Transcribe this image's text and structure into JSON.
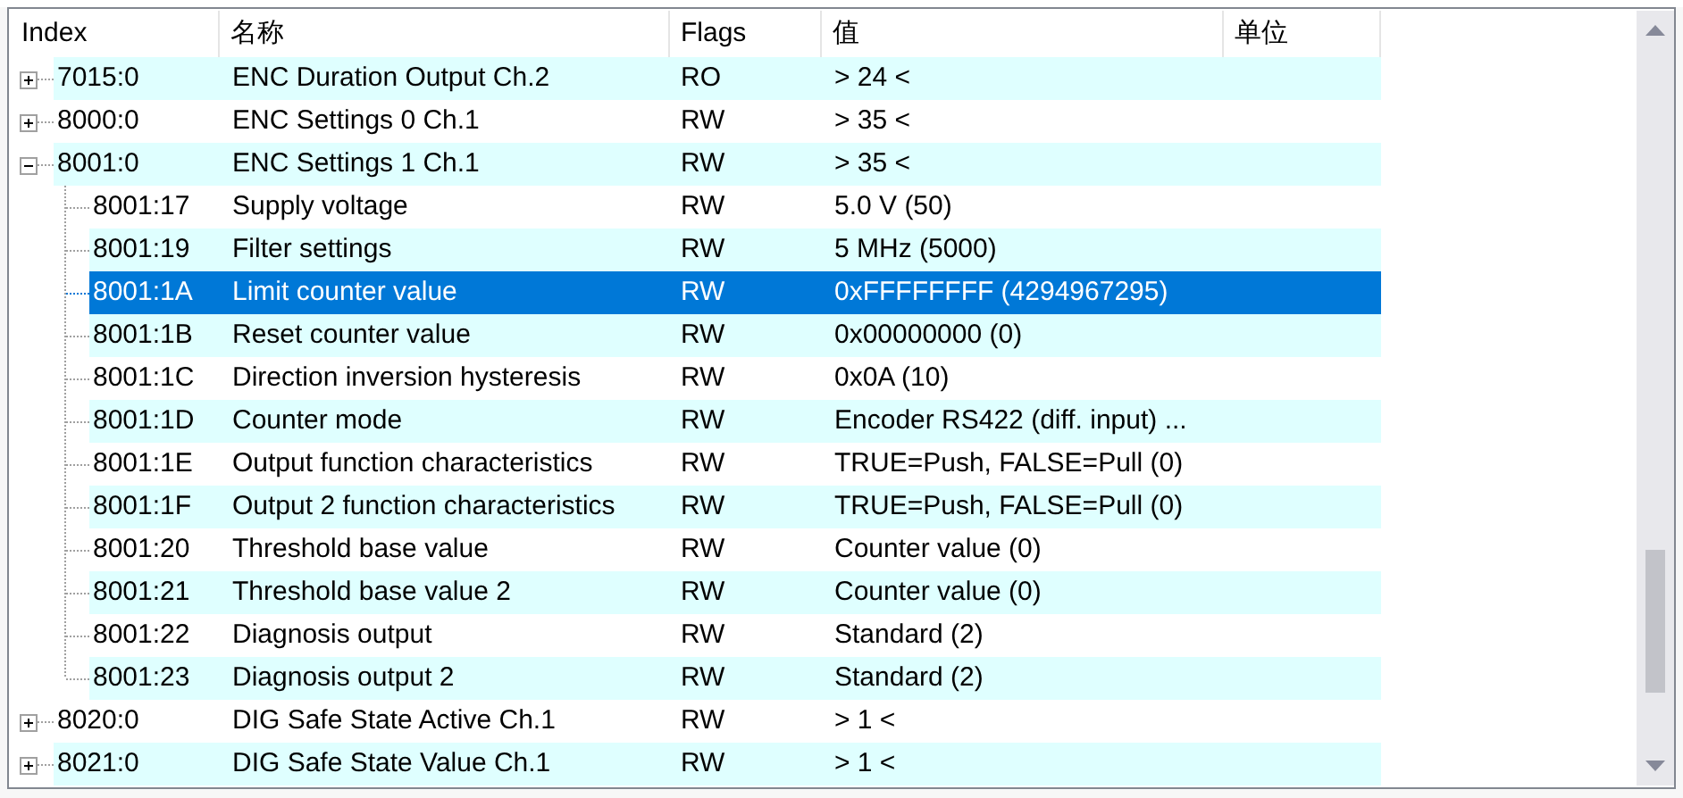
{
  "columns": [
    {
      "label": "Index"
    },
    {
      "label": "名称"
    },
    {
      "label": "Flags"
    },
    {
      "label": "值"
    },
    {
      "label": "单位"
    }
  ],
  "rows": [
    {
      "index": "7015:0",
      "name": "ENC Duration Output Ch.2",
      "flags": "RO",
      "value": "> 24 <",
      "expanded": false,
      "selected": false
    },
    {
      "index": "8000:0",
      "name": "ENC Settings 0 Ch.1",
      "flags": "RW",
      "value": "> 35 <",
      "expanded": false,
      "selected": false
    },
    {
      "index": "8001:0",
      "name": "ENC Settings 1 Ch.1",
      "flags": "RW",
      "value": "> 35 <",
      "expanded": true,
      "selected": false,
      "children": [
        {
          "index": "8001:17",
          "name": "Supply voltage",
          "flags": "RW",
          "value": "5.0 V (50)",
          "selected": false
        },
        {
          "index": "8001:19",
          "name": "Filter settings",
          "flags": "RW",
          "value": "5 MHz (5000)",
          "selected": false
        },
        {
          "index": "8001:1A",
          "name": "Limit counter value",
          "flags": "RW",
          "value": "0xFFFFFFFF (4294967295)",
          "selected": true
        },
        {
          "index": "8001:1B",
          "name": "Reset counter value",
          "flags": "RW",
          "value": "0x00000000 (0)",
          "selected": false
        },
        {
          "index": "8001:1C",
          "name": "Direction inversion hysteresis",
          "flags": "RW",
          "value": "0x0A (10)",
          "selected": false
        },
        {
          "index": "8001:1D",
          "name": "Counter mode",
          "flags": "RW",
          "value": "Encoder RS422 (diff. input) ...",
          "selected": false
        },
        {
          "index": "8001:1E",
          "name": "Output function characteristics",
          "flags": "RW",
          "value": "TRUE=Push, FALSE=Pull (0)",
          "selected": false
        },
        {
          "index": "8001:1F",
          "name": "Output 2 function characteristics",
          "flags": "RW",
          "value": "TRUE=Push, FALSE=Pull (0)",
          "selected": false
        },
        {
          "index": "8001:20",
          "name": "Threshold base value",
          "flags": "RW",
          "value": "Counter value (0)",
          "selected": false
        },
        {
          "index": "8001:21",
          "name": "Threshold base value 2",
          "flags": "RW",
          "value": "Counter value (0)",
          "selected": false
        },
        {
          "index": "8001:22",
          "name": "Diagnosis output",
          "flags": "RW",
          "value": "Standard (2)",
          "selected": false
        },
        {
          "index": "8001:23",
          "name": "Diagnosis output 2",
          "flags": "RW",
          "value": "Standard (2)",
          "selected": false
        }
      ]
    },
    {
      "index": "8020:0",
      "name": "DIG Safe State Active Ch.1",
      "flags": "RW",
      "value": "> 1 <",
      "expanded": false,
      "selected": false
    },
    {
      "index": "8021:0",
      "name": "DIG Safe State Value Ch.1",
      "flags": "RW",
      "value": "> 1 <",
      "expanded": false,
      "selected": false
    }
  ]
}
